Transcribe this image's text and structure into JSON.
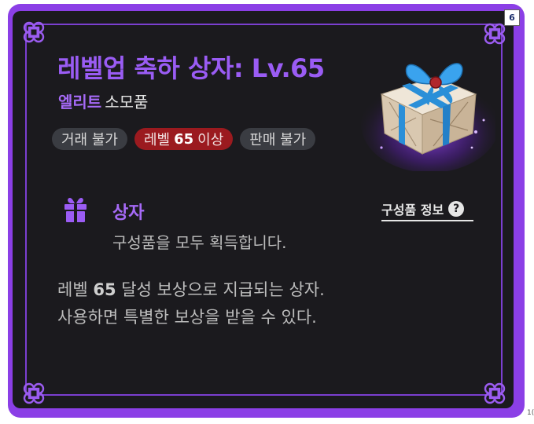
{
  "item": {
    "title": "레벨업 축하 상자: Lv.65",
    "grade": "엘리트",
    "category": "소모품",
    "tags": {
      "trade": "거래 불가",
      "level_prefix": "레벨",
      "level_value": "65",
      "level_suffix": "이상",
      "sell": "판매 불가"
    },
    "type_label": "상자",
    "type_desc": "구성품을 모두 획득합니다.",
    "components_link": "구성품 정보",
    "flavor": {
      "line1_prefix": "레벨",
      "line1_level": "65",
      "line1_suffix": "달성 보상으로 지급되는 상자.",
      "line2": "사용하면 특별한 보상을 받을 수 있다."
    }
  },
  "badge_number": "6",
  "colors": {
    "frame": "#8b3fe6",
    "panel": "#1b1a1e",
    "title": "#9a5cf4",
    "tag_bg": "#3a3c42",
    "tag_red": "#9b1a1f"
  },
  "icons": {
    "gift": "gift-icon",
    "help": "question-circle-icon",
    "corner": "ornament-knot-icon"
  }
}
